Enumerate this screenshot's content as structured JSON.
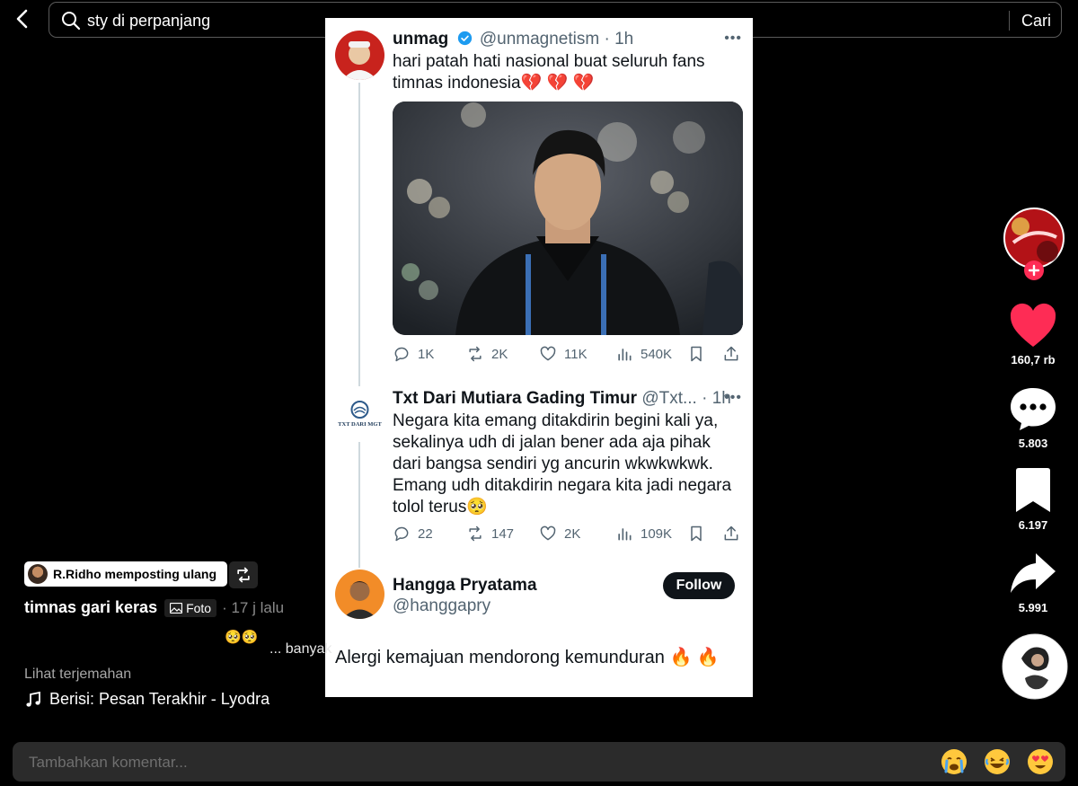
{
  "search": {
    "query": "sty di perpanjang",
    "submit_label": "Cari"
  },
  "card": {
    "tweet1": {
      "name": "unmag",
      "handle": "@unmagnetism",
      "time": "· 1h",
      "text": "hari patah hati nasional buat seluruh fans timnas indonesia💔 💔 💔",
      "stats": {
        "replies": "1K",
        "reposts": "2K",
        "likes": "11K",
        "views": "540K"
      }
    },
    "tweet2": {
      "name": "Txt Dari Mutiara Gading Timur",
      "handle": "@Txt...",
      "time": "· 1h",
      "avatar_text": "TXT DARI MGT",
      "text": "Negara kita emang ditakdirin begini kali ya, sekalinya udh di jalan bener ada aja pihak dari bangsa sendiri yg ancurin wkwkwkwk. Emang udh ditakdirin negara kita jadi negara tolol terus🥺",
      "stats": {
        "replies": "22",
        "reposts": "147",
        "likes": "2K",
        "views": "109K"
      }
    },
    "tweet3": {
      "name": "Hangga Pryatama",
      "handle": "@hanggapry",
      "follow_label": "Follow",
      "text": "Alergi kemajuan mendorong kemunduran 🔥 🔥"
    }
  },
  "side_actions": {
    "likes": "160,7 rb",
    "comments": "5.803",
    "bookmarks": "6.197",
    "shares": "5.991",
    "brand_color": "#fe2c55"
  },
  "caption": {
    "repost_label": "R.Ridho memposting ulang",
    "title": "timnas gari keras",
    "tag": "Foto",
    "time": "· 17 j lalu",
    "emojis": "🥺🥺",
    "more": "... banyak",
    "translate": "Lihat terjemahan",
    "music": "Berisi: Pesan Terakhir - Lyodra"
  },
  "comment": {
    "placeholder": "Tambahkan komentar..."
  }
}
